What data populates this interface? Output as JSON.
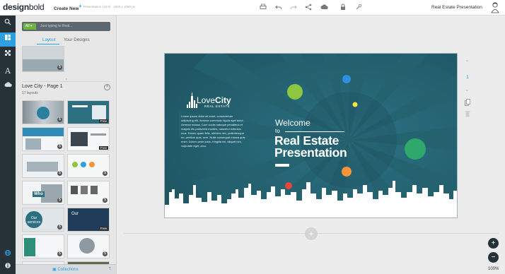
{
  "app": {
    "logo_bold": "design",
    "logo_light": "bold"
  },
  "topbar": {
    "create_new": "Create New",
    "create_plus": "+",
    "doc_meta": "Presentation (16:9) - 1920 x 1080 px",
    "doc_title": "Real Estate Presentation",
    "tools": [
      "print-icon",
      "undo-icon",
      "redo-icon",
      "share-icon",
      "cloud-download-icon",
      "lock-icon",
      "wrench-icon"
    ]
  },
  "rail": {
    "items": [
      "search-icon",
      "layout-icon",
      "pattern-icon",
      "text-icon",
      "upload-cloud-icon"
    ]
  },
  "panel": {
    "search": {
      "filter": "All",
      "placeholder": "Just typing to Real..."
    },
    "tabs": [
      "Layout",
      "Your Designs"
    ],
    "page_name": "Love City - Page 1",
    "layout_count": "17 layouts",
    "close_symbol": "×",
    "free_label": "Free",
    "who_label": "Who",
    "our_services_label": "Our services",
    "our_label": "Our",
    "collections": "Collections"
  },
  "slide": {
    "city_light": "Love",
    "city_bold": "City",
    "city_sub": "REAL ESTATE",
    "body": "Lorem ipsum dolor sit amet, consectetuer adipiscing elit. Aenean commodo ligula eget dolor. Aenean massa. Cum sociis natoque penatibus et magnis dis parturient montes, nascetur ridiculus mus. Donec quam felis, ultricies nec, pellentesque eu, pretium quis, sem. Nulla consequat massa quis enim. Donec pede justo, fringilla vel, aliquet nec, vulputate eget, arcu.",
    "welcome": "Welcome",
    "to": "to",
    "title_line1": "Real Estate",
    "title_line2": "Presentation",
    "colors": {
      "bg": "#23606f",
      "green": "#8dc63f",
      "blue": "#2f8fe0",
      "yellow": "#f5e642",
      "teal_green": "#2ea86b",
      "orange": "#f7943a",
      "red": "#e6463a"
    }
  },
  "canvas": {
    "add_page": "+",
    "page_number": "1"
  },
  "zoom": {
    "plus": "+",
    "minus": "−",
    "level": "100%"
  }
}
